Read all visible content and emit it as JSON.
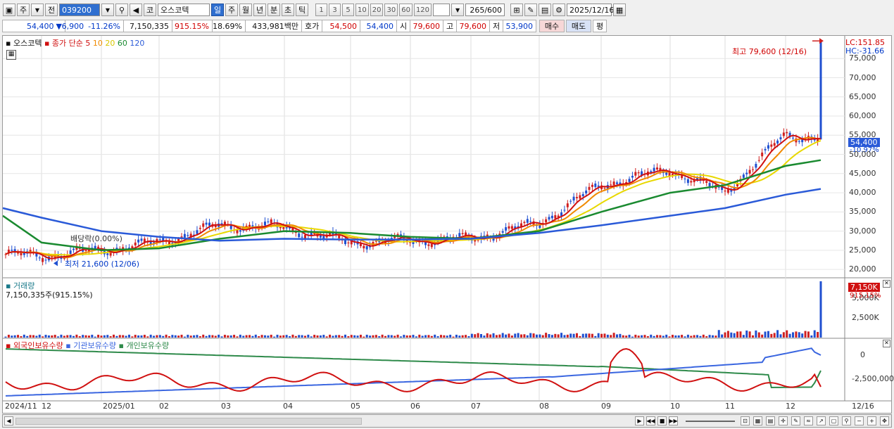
{
  "toolbar": {
    "type": "주",
    "prev": "전",
    "code": "039200",
    "market_flag": "코",
    "name": "오스코텍",
    "periods": [
      "일",
      "주",
      "월",
      "년",
      "분",
      "초",
      "틱"
    ],
    "period_selected": "일",
    "intervals": [
      "1",
      "3",
      "5",
      "10",
      "20",
      "30",
      "60",
      "120"
    ],
    "count": "265",
    "count_max": "/600",
    "date": "2025/12/16"
  },
  "quote": {
    "price": "54,400",
    "arrow": "▼",
    "change": "6,900",
    "change_pct": "-11.26%",
    "volume": "7,150,335",
    "volume_ratio": "915.15%",
    "turnover": "18.69%",
    "amount": "433,981백만",
    "bid_label": "호가",
    "bid": "54,500",
    "ask": "54,400",
    "open_label": "시",
    "open": "79,600",
    "high_label": "고",
    "high": "79,600",
    "low_label": "저",
    "low": "53,900",
    "buy": "매수",
    "sell": "매도",
    "avg": "평"
  },
  "price_panel": {
    "legend_name": "오스코텍",
    "legend_ma_title": "종가 단순",
    "legend_ma": [
      "5",
      "10",
      "20",
      "60",
      "120"
    ],
    "lc": "LC:151.85",
    "hc": "HC:-31.66",
    "high_note": "최고 79,600 (12/16)",
    "low_note": "최저 21,600 (12/06)",
    "dividend_note": "배당락(0.00%)",
    "current_price": "54,400",
    "current_pct": "-10.97%",
    "y_ticks": [
      "75,000",
      "70,000",
      "65,000",
      "60,000",
      "55,000",
      "50,000",
      "45,000",
      "40,000",
      "35,000",
      "30,000",
      "25,000",
      "20,000"
    ]
  },
  "volume_panel": {
    "title": "거래량",
    "value": "7,150,335주(915.15%)",
    "current": "7,150K",
    "ratio": "915.15%",
    "y_ticks": [
      "5,000K",
      "2,500K"
    ]
  },
  "holding_panel": {
    "legend": [
      "외국인보유수량",
      "기관보유수량",
      "개인보유수량"
    ],
    "y_ticks": [
      "0",
      "-2,500,000"
    ]
  },
  "x_axis": [
    "2024/11",
    "12",
    "2025/01",
    "02",
    "03",
    "04",
    "05",
    "06",
    "07",
    "08",
    "09",
    "10",
    "11",
    "12",
    "12/16"
  ],
  "colors": {
    "ma5": "#d01010",
    "ma10": "#f08a00",
    "ma20": "#e8d800",
    "ma60": "#1a8a30",
    "ma120": "#2a5ad8",
    "up": "#d02020",
    "down": "#2050d0",
    "foreign": "#d01010",
    "institution": "#3a66e0",
    "individual": "#2e8a4a"
  },
  "chart_data": {
    "type": "line",
    "title": "오스코텍",
    "x": [
      "2024/11",
      "12",
      "2025/01",
      "02",
      "03",
      "04",
      "05",
      "06",
      "07",
      "08",
      "09",
      "10",
      "11",
      "12",
      "12/16"
    ],
    "price_close": [
      24000,
      23500,
      25000,
      27000,
      31500,
      31000,
      27000,
      27500,
      28000,
      32000,
      42000,
      46000,
      40000,
      55000,
      54400
    ],
    "ma60": [
      34000,
      27000,
      25000,
      25500,
      28000,
      30000,
      29500,
      28500,
      28000,
      30000,
      35000,
      40000,
      42000,
      47000,
      48500
    ],
    "ma120": [
      36000,
      33500,
      30000,
      28500,
      27500,
      28000,
      27800,
      27800,
      28000,
      29500,
      31500,
      34000,
      36000,
      39500,
      41000
    ],
    "ylim": [
      18000,
      80000
    ],
    "volume_peak_k": 7150,
    "ylim_volume_k": [
      0,
      7500
    ]
  }
}
